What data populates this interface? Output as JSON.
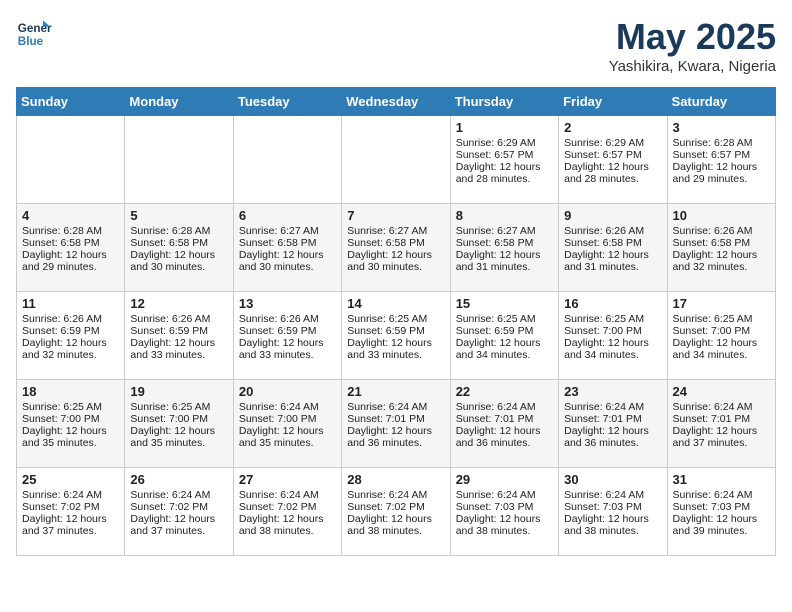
{
  "header": {
    "logo_line1": "General",
    "logo_line2": "Blue",
    "month_title": "May 2025",
    "subtitle": "Yashikira, Kwara, Nigeria"
  },
  "weekdays": [
    "Sunday",
    "Monday",
    "Tuesday",
    "Wednesday",
    "Thursday",
    "Friday",
    "Saturday"
  ],
  "weeks": [
    [
      {
        "day": "",
        "sunrise": "",
        "sunset": "",
        "daylight": ""
      },
      {
        "day": "",
        "sunrise": "",
        "sunset": "",
        "daylight": ""
      },
      {
        "day": "",
        "sunrise": "",
        "sunset": "",
        "daylight": ""
      },
      {
        "day": "",
        "sunrise": "",
        "sunset": "",
        "daylight": ""
      },
      {
        "day": "1",
        "sunrise": "Sunrise: 6:29 AM",
        "sunset": "Sunset: 6:57 PM",
        "daylight": "Daylight: 12 hours and 28 minutes."
      },
      {
        "day": "2",
        "sunrise": "Sunrise: 6:29 AM",
        "sunset": "Sunset: 6:57 PM",
        "daylight": "Daylight: 12 hours and 28 minutes."
      },
      {
        "day": "3",
        "sunrise": "Sunrise: 6:28 AM",
        "sunset": "Sunset: 6:57 PM",
        "daylight": "Daylight: 12 hours and 29 minutes."
      }
    ],
    [
      {
        "day": "4",
        "sunrise": "Sunrise: 6:28 AM",
        "sunset": "Sunset: 6:58 PM",
        "daylight": "Daylight: 12 hours and 29 minutes."
      },
      {
        "day": "5",
        "sunrise": "Sunrise: 6:28 AM",
        "sunset": "Sunset: 6:58 PM",
        "daylight": "Daylight: 12 hours and 30 minutes."
      },
      {
        "day": "6",
        "sunrise": "Sunrise: 6:27 AM",
        "sunset": "Sunset: 6:58 PM",
        "daylight": "Daylight: 12 hours and 30 minutes."
      },
      {
        "day": "7",
        "sunrise": "Sunrise: 6:27 AM",
        "sunset": "Sunset: 6:58 PM",
        "daylight": "Daylight: 12 hours and 30 minutes."
      },
      {
        "day": "8",
        "sunrise": "Sunrise: 6:27 AM",
        "sunset": "Sunset: 6:58 PM",
        "daylight": "Daylight: 12 hours and 31 minutes."
      },
      {
        "day": "9",
        "sunrise": "Sunrise: 6:26 AM",
        "sunset": "Sunset: 6:58 PM",
        "daylight": "Daylight: 12 hours and 31 minutes."
      },
      {
        "day": "10",
        "sunrise": "Sunrise: 6:26 AM",
        "sunset": "Sunset: 6:58 PM",
        "daylight": "Daylight: 12 hours and 32 minutes."
      }
    ],
    [
      {
        "day": "11",
        "sunrise": "Sunrise: 6:26 AM",
        "sunset": "Sunset: 6:59 PM",
        "daylight": "Daylight: 12 hours and 32 minutes."
      },
      {
        "day": "12",
        "sunrise": "Sunrise: 6:26 AM",
        "sunset": "Sunset: 6:59 PM",
        "daylight": "Daylight: 12 hours and 33 minutes."
      },
      {
        "day": "13",
        "sunrise": "Sunrise: 6:26 AM",
        "sunset": "Sunset: 6:59 PM",
        "daylight": "Daylight: 12 hours and 33 minutes."
      },
      {
        "day": "14",
        "sunrise": "Sunrise: 6:25 AM",
        "sunset": "Sunset: 6:59 PM",
        "daylight": "Daylight: 12 hours and 33 minutes."
      },
      {
        "day": "15",
        "sunrise": "Sunrise: 6:25 AM",
        "sunset": "Sunset: 6:59 PM",
        "daylight": "Daylight: 12 hours and 34 minutes."
      },
      {
        "day": "16",
        "sunrise": "Sunrise: 6:25 AM",
        "sunset": "Sunset: 7:00 PM",
        "daylight": "Daylight: 12 hours and 34 minutes."
      },
      {
        "day": "17",
        "sunrise": "Sunrise: 6:25 AM",
        "sunset": "Sunset: 7:00 PM",
        "daylight": "Daylight: 12 hours and 34 minutes."
      }
    ],
    [
      {
        "day": "18",
        "sunrise": "Sunrise: 6:25 AM",
        "sunset": "Sunset: 7:00 PM",
        "daylight": "Daylight: 12 hours and 35 minutes."
      },
      {
        "day": "19",
        "sunrise": "Sunrise: 6:25 AM",
        "sunset": "Sunset: 7:00 PM",
        "daylight": "Daylight: 12 hours and 35 minutes."
      },
      {
        "day": "20",
        "sunrise": "Sunrise: 6:24 AM",
        "sunset": "Sunset: 7:00 PM",
        "daylight": "Daylight: 12 hours and 35 minutes."
      },
      {
        "day": "21",
        "sunrise": "Sunrise: 6:24 AM",
        "sunset": "Sunset: 7:01 PM",
        "daylight": "Daylight: 12 hours and 36 minutes."
      },
      {
        "day": "22",
        "sunrise": "Sunrise: 6:24 AM",
        "sunset": "Sunset: 7:01 PM",
        "daylight": "Daylight: 12 hours and 36 minutes."
      },
      {
        "day": "23",
        "sunrise": "Sunrise: 6:24 AM",
        "sunset": "Sunset: 7:01 PM",
        "daylight": "Daylight: 12 hours and 36 minutes."
      },
      {
        "day": "24",
        "sunrise": "Sunrise: 6:24 AM",
        "sunset": "Sunset: 7:01 PM",
        "daylight": "Daylight: 12 hours and 37 minutes."
      }
    ],
    [
      {
        "day": "25",
        "sunrise": "Sunrise: 6:24 AM",
        "sunset": "Sunset: 7:02 PM",
        "daylight": "Daylight: 12 hours and 37 minutes."
      },
      {
        "day": "26",
        "sunrise": "Sunrise: 6:24 AM",
        "sunset": "Sunset: 7:02 PM",
        "daylight": "Daylight: 12 hours and 37 minutes."
      },
      {
        "day": "27",
        "sunrise": "Sunrise: 6:24 AM",
        "sunset": "Sunset: 7:02 PM",
        "daylight": "Daylight: 12 hours and 38 minutes."
      },
      {
        "day": "28",
        "sunrise": "Sunrise: 6:24 AM",
        "sunset": "Sunset: 7:02 PM",
        "daylight": "Daylight: 12 hours and 38 minutes."
      },
      {
        "day": "29",
        "sunrise": "Sunrise: 6:24 AM",
        "sunset": "Sunset: 7:03 PM",
        "daylight": "Daylight: 12 hours and 38 minutes."
      },
      {
        "day": "30",
        "sunrise": "Sunrise: 6:24 AM",
        "sunset": "Sunset: 7:03 PM",
        "daylight": "Daylight: 12 hours and 38 minutes."
      },
      {
        "day": "31",
        "sunrise": "Sunrise: 6:24 AM",
        "sunset": "Sunset: 7:03 PM",
        "daylight": "Daylight: 12 hours and 39 minutes."
      }
    ]
  ]
}
